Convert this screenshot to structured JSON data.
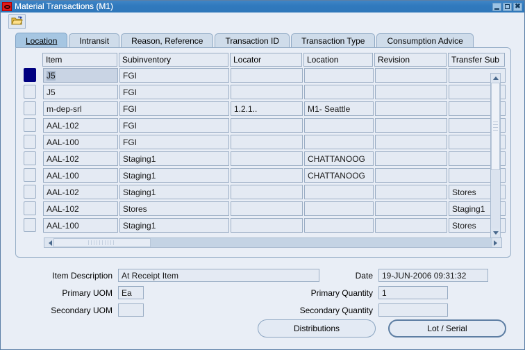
{
  "window": {
    "title": "Material Transactions (M1)",
    "app_icon": "oracle-logo-icon",
    "controls": {
      "minimize": "minimize-icon",
      "maximize": "maximize-icon",
      "close": "close-icon"
    }
  },
  "toolbar": {
    "items": [
      {
        "icon": "open-folder-icon",
        "label": ""
      }
    ]
  },
  "tabs": [
    {
      "label": "Location",
      "active": true
    },
    {
      "label": "Intransit",
      "active": false
    },
    {
      "label": "Reason, Reference",
      "active": false
    },
    {
      "label": "Transaction ID",
      "active": false
    },
    {
      "label": "Transaction Type",
      "active": false
    },
    {
      "label": "Consumption Advice",
      "active": false
    }
  ],
  "grid": {
    "columns": [
      {
        "key": "item",
        "label": "Item"
      },
      {
        "key": "subinventory",
        "label": "Subinventory"
      },
      {
        "key": "locator",
        "label": "Locator"
      },
      {
        "key": "location",
        "label": "Location"
      },
      {
        "key": "revision",
        "label": "Revision"
      },
      {
        "key": "transfer_sub",
        "label": "Transfer Sub"
      }
    ],
    "rows": [
      {
        "selected": true,
        "item": "J5",
        "subinventory": "FGI",
        "locator": "",
        "location": "",
        "revision": "",
        "transfer_sub": ""
      },
      {
        "selected": false,
        "item": "J5",
        "subinventory": "FGI",
        "locator": "",
        "location": "",
        "revision": "",
        "transfer_sub": ""
      },
      {
        "selected": false,
        "item": "m-dep-srl",
        "subinventory": "FGI",
        "locator": "1.2.1..",
        "location": "M1- Seattle",
        "revision": "",
        "transfer_sub": ""
      },
      {
        "selected": false,
        "item": "AAL-102",
        "subinventory": "FGI",
        "locator": "",
        "location": "",
        "revision": "",
        "transfer_sub": ""
      },
      {
        "selected": false,
        "item": "AAL-100",
        "subinventory": "FGI",
        "locator": "",
        "location": "",
        "revision": "",
        "transfer_sub": ""
      },
      {
        "selected": false,
        "item": "AAL-102",
        "subinventory": "Staging1",
        "locator": "",
        "location": "CHATTANOOG",
        "revision": "",
        "transfer_sub": ""
      },
      {
        "selected": false,
        "item": "AAL-100",
        "subinventory": "Staging1",
        "locator": "",
        "location": "CHATTANOOG",
        "revision": "",
        "transfer_sub": ""
      },
      {
        "selected": false,
        "item": "AAL-102",
        "subinventory": "Staging1",
        "locator": "",
        "location": "",
        "revision": "",
        "transfer_sub": "Stores"
      },
      {
        "selected": false,
        "item": "AAL-102",
        "subinventory": "Stores",
        "locator": "",
        "location": "",
        "revision": "",
        "transfer_sub": "Staging1"
      },
      {
        "selected": false,
        "item": "AAL-100",
        "subinventory": "Staging1",
        "locator": "",
        "location": "",
        "revision": "",
        "transfer_sub": "Stores"
      }
    ]
  },
  "form": {
    "item_description_label": "Item Description",
    "item_description_value": "At Receipt Item",
    "primary_uom_label": "Primary UOM",
    "primary_uom_value": "Ea",
    "secondary_uom_label": "Secondary UOM",
    "secondary_uom_value": "",
    "date_label": "Date",
    "date_value": "19-JUN-2006 09:31:32",
    "primary_quantity_label": "Primary Quantity",
    "primary_quantity_value": "1",
    "secondary_quantity_label": "Secondary Quantity",
    "secondary_quantity_value": ""
  },
  "buttons": {
    "distributions": "Distributions",
    "lot_serial": "Lot / Serial"
  },
  "colors": {
    "titlebar": "#3079bd",
    "panel": "#e9eef6",
    "field": "#e4eaf3",
    "selected_row": "#000080",
    "active_tab": "#a6c6e2"
  }
}
